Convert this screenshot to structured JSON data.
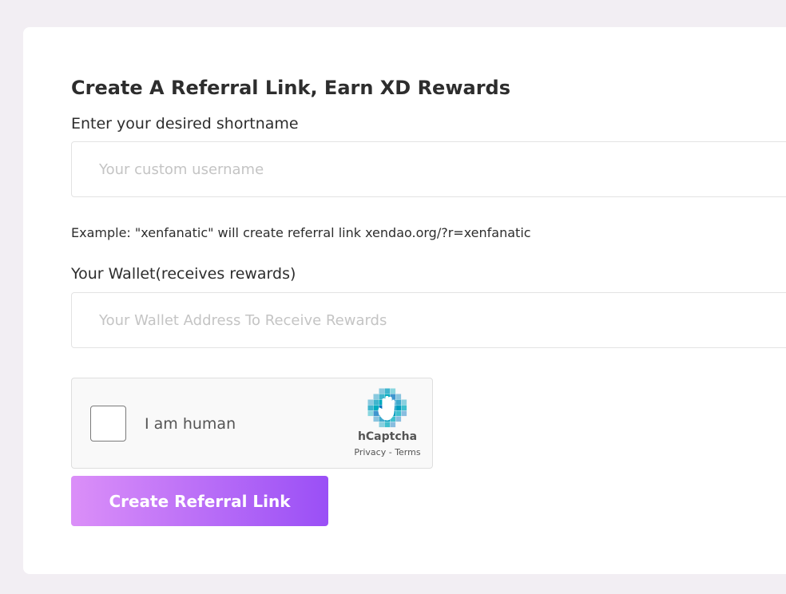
{
  "form": {
    "title": "Create A Referral Link, Earn XD Rewards",
    "shortname_label": "Enter your desired shortname",
    "shortname_placeholder": "Your custom username",
    "shortname_value": "",
    "example_text": "Example: \"xenfanatic\" will create referral link xendao.org/?r=xenfanatic",
    "wallet_label": "Your Wallet(receives rewards)",
    "wallet_placeholder": "Your Wallet Address To Receive Rewards",
    "wallet_value": "",
    "submit_label": "Create Referral Link",
    "submit_gradient": [
      "#db8ff8",
      "#9a4ff6"
    ]
  },
  "captcha": {
    "checkbox_label": "I am human",
    "checked": false,
    "brand": "hCaptcha",
    "privacy_label": "Privacy",
    "separator": " - ",
    "terms_label": "Terms",
    "logo_icon": "hcaptcha-hand-icon",
    "logo_colors": [
      "#0074bf",
      "#0082bf",
      "#008fbf",
      "#009dbf",
      "#00abbf"
    ]
  },
  "colors": {
    "page_background": "#f2eef3",
    "card_background": "#ffffff",
    "text": "#2d2d2d",
    "placeholder": "#c4c4c4"
  }
}
